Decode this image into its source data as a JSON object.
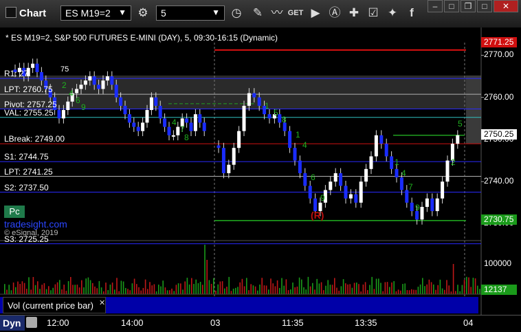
{
  "app": {
    "title": "Chart"
  },
  "toolbar": {
    "symbol": "ES M19=2",
    "interval": "5",
    "icons": [
      "gear-icon",
      "clock-icon",
      "pencil-icon",
      "line-study-icon",
      "get-icon",
      "play-icon",
      "alert-icon",
      "link-icon",
      "chat-icon",
      "twitter-icon",
      "facebook-icon"
    ]
  },
  "window": {
    "minimize": "–",
    "restore": "□",
    "close": "✕"
  },
  "chart": {
    "header": "* ES M19=2, S&P 500 FUTURES E-MINI (DAY), 5, 09:30-16:15 (Dynamic)",
    "levels": [
      {
        "label": "R1: 27",
        "price": 2764.5,
        "color": "#2a2aff"
      },
      {
        "label": "LPT: 2760.75",
        "price": 2760.75,
        "color": "#b0b0b0"
      },
      {
        "label": "Pivot: 2757.25",
        "price": 2757.25,
        "color": "#2a2aff"
      },
      {
        "label": "VAL: 2755.25",
        "price": 2755.25,
        "color": "#30c0c0"
      },
      {
        "label": "LBreak: 2749.00",
        "price": 2749.0,
        "color": "#d01010"
      },
      {
        "label": "S1: 2744.75",
        "price": 2744.75,
        "color": "#2a2aff"
      },
      {
        "label": "LPT: 2741.25",
        "price": 2741.25,
        "color": "#b0b0b0"
      },
      {
        "label": "S2: 2737.50",
        "price": 2737.5,
        "color": "#2a2aff"
      },
      {
        "label": "S3: 2725.25",
        "price": 2725.25,
        "color": "#2a2aff"
      }
    ],
    "r1_suffix": "75",
    "red_level": 2771.25,
    "green_level": 2730.75,
    "last_price": "2750.25",
    "red_tag": "2771.25",
    "green_tag": "2730.75",
    "y_ticks": [
      "2770.00",
      "2760.00",
      "2750.00",
      "2740.00",
      "2730.00"
    ],
    "pc_label": "Pc",
    "brand": "tradesight.com",
    "copyright": "© eSignal, 2019",
    "r_marker": "(R)"
  },
  "volume": {
    "label": "Vol (current price bar)",
    "tick": "100000",
    "last": "12137"
  },
  "xaxis": {
    "mode": "Dyn",
    "ticks": [
      "12:00",
      "14:00",
      "03",
      "11:35",
      "13:35",
      "04"
    ]
  },
  "chart_data": {
    "type": "candlestick",
    "title": "* ES M19=2, S&P 500 FUTURES E-MINI (DAY), 5, 09:30-16:15 (Dynamic)",
    "ylim": [
      2726,
      2773
    ],
    "last": 2750.25,
    "y_ticks": [
      2770,
      2760,
      2750,
      2740,
      2730
    ],
    "closes_day1": [
      2766,
      2767,
      2765,
      2767,
      2768,
      2766,
      2764,
      2762,
      2760,
      2757,
      2755,
      2757,
      2759,
      2761,
      2762,
      2763,
      2764,
      2765,
      2763,
      2762,
      2764,
      2765,
      2763,
      2760,
      2758,
      2756,
      2754,
      2753,
      2752,
      2754,
      2757,
      2760,
      2758,
      2755,
      2753,
      2751,
      2751,
      2753,
      2755,
      2754,
      2752,
      2756,
      2754,
      2752
    ],
    "closes_day2": [
      2748,
      2742,
      2744,
      2748,
      2752,
      2758,
      2761,
      2760,
      2758,
      2756,
      2755,
      2756,
      2754,
      2752,
      2748,
      2745,
      2742,
      2739,
      2736,
      2733,
      2735,
      2738,
      2740,
      2742,
      2739,
      2736,
      2737,
      2735,
      2740,
      2743,
      2746,
      2751,
      2749,
      2746,
      2743,
      2741,
      2738,
      2735,
      2733,
      2731,
      2734,
      2736,
      2733,
      2736,
      2740,
      2745,
      2749,
      2751
    ],
    "volume_note": "volume histogram, scale tick 100000, last bar 12137"
  }
}
